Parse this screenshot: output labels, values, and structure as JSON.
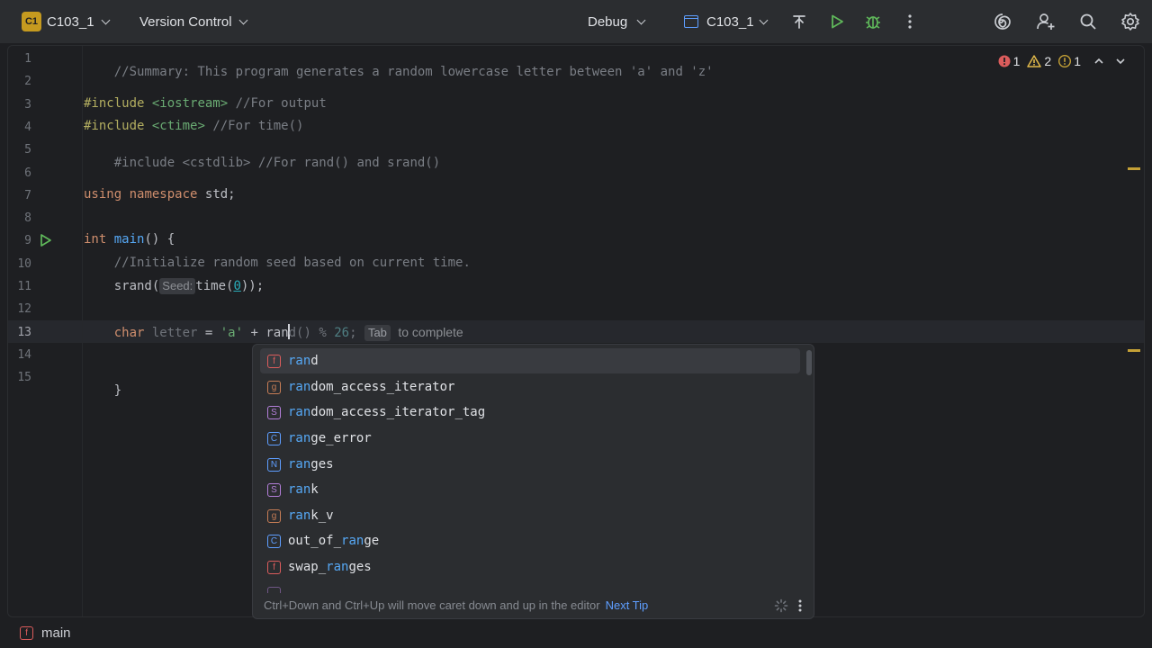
{
  "titlebar": {
    "project_badge": "C1",
    "project_name": "C103_1",
    "vcs_label": "Version Control",
    "run_mode": "Debug",
    "run_config": "C103_1",
    "icons": [
      "t-chevron-icon",
      "run-icon",
      "debug-icon",
      "more-vert-icon",
      "ai-spiral-icon",
      "add-user-icon",
      "search-icon",
      "settings-gear-icon"
    ]
  },
  "editor": {
    "line_numbers": [
      "1",
      "2",
      "3",
      "4",
      "5",
      "6",
      "7",
      "8",
      "9",
      "10",
      "11",
      "12",
      "13",
      "14",
      "15"
    ],
    "code": {
      "l1": "//Summary: This program generates a random lowercase letter between 'a' and 'z'",
      "l3_dir": "#include",
      "l3_hdr": "<iostream>",
      "l3_cmt": "//For output",
      "l4_dir": "#include",
      "l4_hdr": "<ctime>",
      "l4_cmt": "//For time()",
      "l5": "#include <cstdlib> //For rand() and srand()",
      "l7_kw1": "using",
      "l7_kw2": "namespace",
      "l7_rest": "std;",
      "l9_kw": "int",
      "l9_fn": "main",
      "l9_rest": "() {",
      "l10": "//Initialize random seed based on current time.",
      "l11_a": "srand(",
      "l11_hint": "Seed:",
      "l11_b": "time(",
      "l11_num": "0",
      "l11_c": "));",
      "l13_kw": "char",
      "l13_a": "letter",
      "l13_b": " = ",
      "l13_str": "'a'",
      "l13_c": " + ran",
      "l13_ghost1": "d() % ",
      "l13_ghost_num": "26",
      "l13_ghost2": ";",
      "l13_tab_key": "Tab",
      "l13_tab_text": "to complete",
      "l15": "}"
    },
    "inspections": {
      "errors": "1",
      "warnings": "2",
      "weak_warnings": "1"
    }
  },
  "completion": {
    "items": [
      {
        "kind": "f",
        "match": "ran",
        "rest": "d",
        "pre": ""
      },
      {
        "kind": "g",
        "match": "ran",
        "rest": "dom_access_iterator",
        "pre": ""
      },
      {
        "kind": "S",
        "match": "ran",
        "rest": "dom_access_iterator_tag",
        "pre": ""
      },
      {
        "kind": "C",
        "match": "ran",
        "rest": "ge_error",
        "pre": ""
      },
      {
        "kind": "N",
        "match": "ran",
        "rest": "ges",
        "pre": ""
      },
      {
        "kind": "S",
        "match": "ran",
        "rest": "k",
        "pre": ""
      },
      {
        "kind": "g",
        "match": "ran",
        "rest": "k_v",
        "pre": ""
      },
      {
        "kind": "C",
        "pre": "out_of_",
        "match": "ran",
        "rest": "ge"
      },
      {
        "kind": "f",
        "pre": "swap_",
        "match": "ran",
        "rest": "ges"
      }
    ],
    "footer_tip": "Ctrl+Down and Ctrl+Up will move caret down and up in the editor",
    "footer_link": "Next Tip"
  },
  "breadcrumb": {
    "kind": "f",
    "label": "main"
  },
  "colors": {
    "background": "#1e1f22",
    "panel": "#2b2d30",
    "accent": "#5e9eff",
    "run_green": "#5fb85a",
    "error": "#db5c5c",
    "warning": "#e0b84a"
  }
}
